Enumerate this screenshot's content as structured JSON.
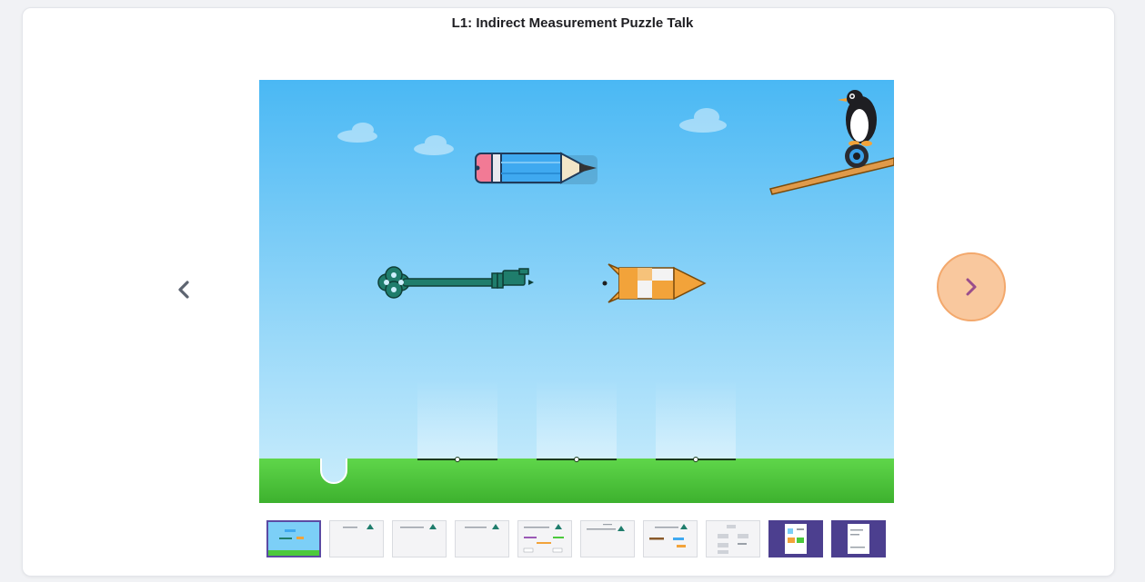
{
  "header": {
    "title": "L1: Indirect Measurement Puzzle Talk"
  },
  "navigation": {
    "prev_icon": "chevron-left-icon",
    "next_icon": "chevron-right-icon"
  },
  "colors": {
    "sky_top": "#4ab8f4",
    "sky_bottom": "#cdeefc",
    "grass": "#4cc93c",
    "next_button_fill": "#f9c89e",
    "next_button_ring": "#f3a86c",
    "next_chevron": "#9a4e8c",
    "active_thumb_border": "#5b4aa3",
    "key": "#1f7d6c",
    "pencil_body": "#3fa9f0",
    "pencil_eraser": "#f27a95",
    "rocket": "#f2a33a"
  },
  "slide": {
    "objects": [
      "pencil",
      "key",
      "rocket",
      "penguin",
      "ramp"
    ],
    "measure_slots": 3
  },
  "thumbnails": {
    "count": 10,
    "active_index": 0,
    "dark_indices": [
      8,
      9
    ]
  }
}
